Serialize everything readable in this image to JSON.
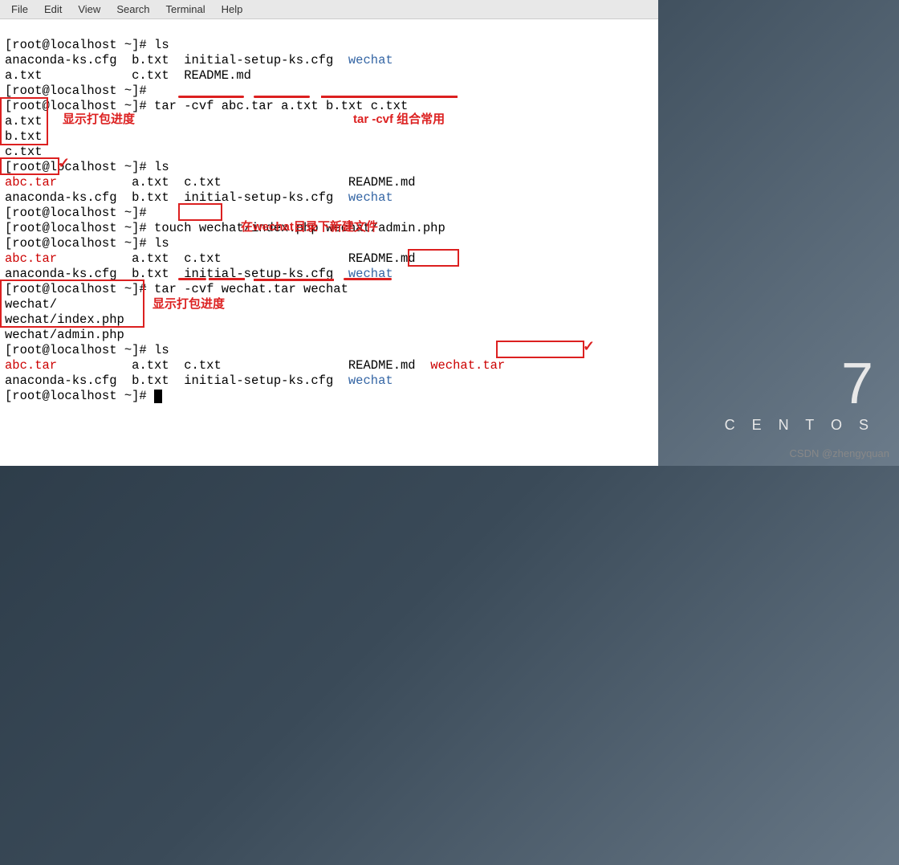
{
  "menubar": {
    "items": [
      "File",
      "Edit",
      "View",
      "Search",
      "Terminal",
      "Help"
    ]
  },
  "terminal": {
    "line0": "[root@localhost ~]# ls",
    "line1a": "anaconda-ks.cfg  b.txt  initial-setup-ks.cfg  ",
    "line1b": "wechat",
    "line2": "a.txt            c.txt  README.md",
    "line3": "[root@localhost ~]#",
    "line4": "[root@localhost ~]# tar -cvf abc.tar a.txt b.txt c.txt",
    "line5": "a.txt",
    "line6": "b.txt",
    "line7": "c.txt",
    "line8": "[root@localhost ~]# ls",
    "line9a": "abc.tar",
    "line9b": "          a.txt  c.txt                 README.md",
    "line10a": "anaconda-ks.cfg  b.txt  initial-setup-ks.cfg  ",
    "line10b": "wechat",
    "line11": "[root@localhost ~]#",
    "line12": "[root@localhost ~]# touch wechat/index.php wechat/admin.php",
    "line13": "[root@localhost ~]# ls",
    "line14a": "abc.tar",
    "line14b": "          a.txt  c.txt                 README.md",
    "line15a": "anaconda-ks.cfg  b.txt  initial-setup-ks.cfg  ",
    "line15b": "wechat",
    "line16": "[root@localhost ~]# tar -cvf wechat.tar wechat",
    "line17": "wechat/",
    "line18": "wechat/index.php",
    "line19": "wechat/admin.php",
    "line20": "[root@localhost ~]# ls",
    "line21a": "abc.tar",
    "line21b": "          a.txt  c.txt                 README.md  ",
    "line21c": "wechat.tar",
    "line22a": "anaconda-ks.cfg  b.txt  initial-setup-ks.cfg  ",
    "line22b": "wechat",
    "line23": "[root@localhost ~]# "
  },
  "annotations": {
    "progress1": "显示打包进度",
    "combo": "tar -cvf 组合常用",
    "newfile": "在wechat目录下新建文件",
    "progress2": "显示打包进度"
  },
  "wallpaper": {
    "version": "7",
    "name": "C E N T O S"
  },
  "watermark": "CSDN @zhengyquan"
}
